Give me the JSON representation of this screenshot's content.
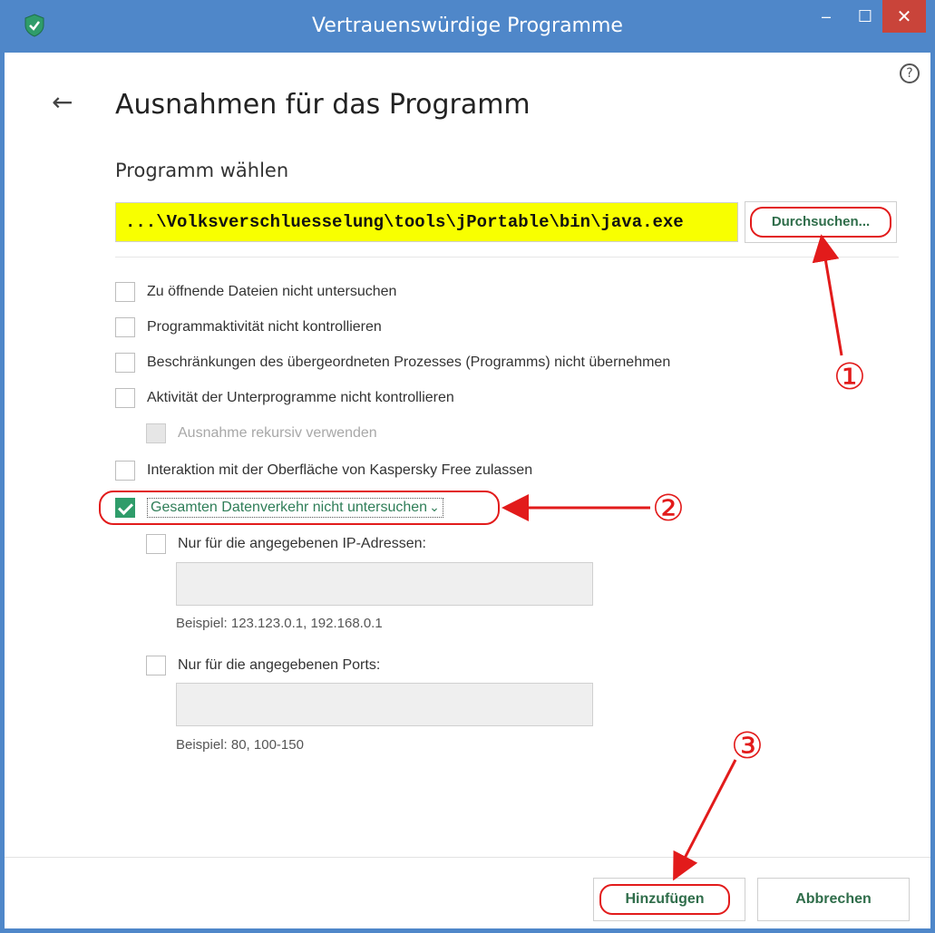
{
  "window": {
    "title": "Vertrauenswürdige Programme",
    "minimize_glyph": "–",
    "maximize_glyph": "☐",
    "close_glyph": "✕"
  },
  "header": {
    "back_icon": "←",
    "help_icon": "?",
    "title": "Ausnahmen für das Programm"
  },
  "program": {
    "label": "Programm wählen",
    "path": "...\\Volksverschluesselung\\tools\\jPortable\\bin\\java.exe",
    "browse_label": "Durchsuchen..."
  },
  "options": [
    {
      "label": "Zu öffnende Dateien nicht untersuchen",
      "checked": false,
      "disabled": false
    },
    {
      "label": "Programmaktivität nicht kontrollieren",
      "checked": false,
      "disabled": false
    },
    {
      "label": "Beschränkungen des übergeordneten Prozesses (Programms) nicht übernehmen",
      "checked": false,
      "disabled": false
    },
    {
      "label": "Aktivität der Unterprogramme nicht kontrollieren",
      "checked": false,
      "disabled": false
    },
    {
      "label": "Ausnahme rekursiv verwenden",
      "checked": false,
      "disabled": true
    },
    {
      "label": "Interaktion mit der Oberfläche von Kaspersky Free zulassen",
      "checked": false,
      "disabled": false
    },
    {
      "label": "Gesamten Datenverkehr nicht untersuchen",
      "checked": true,
      "disabled": false
    }
  ],
  "traffic": {
    "ip_label": "Nur für die angegebenen IP-Adressen:",
    "ip_value": "",
    "ip_hint": "Beispiel: 123.123.0.1, 192.168.0.1",
    "ports_label": "Nur für die angegebenen Ports:",
    "ports_value": "",
    "ports_hint": "Beispiel: 80, 100-150"
  },
  "footer": {
    "add_label": "Hinzufügen",
    "cancel_label": "Abbrechen"
  },
  "annotations": {
    "marker_1": "①",
    "marker_2": "②",
    "marker_3": "③"
  },
  "colors": {
    "titlebar": "#4f87c9",
    "close": "#c9443a",
    "highlight_path": "#f8ff00",
    "annotation_red": "#e21b1b",
    "accent_green": "#2f9c6a"
  }
}
